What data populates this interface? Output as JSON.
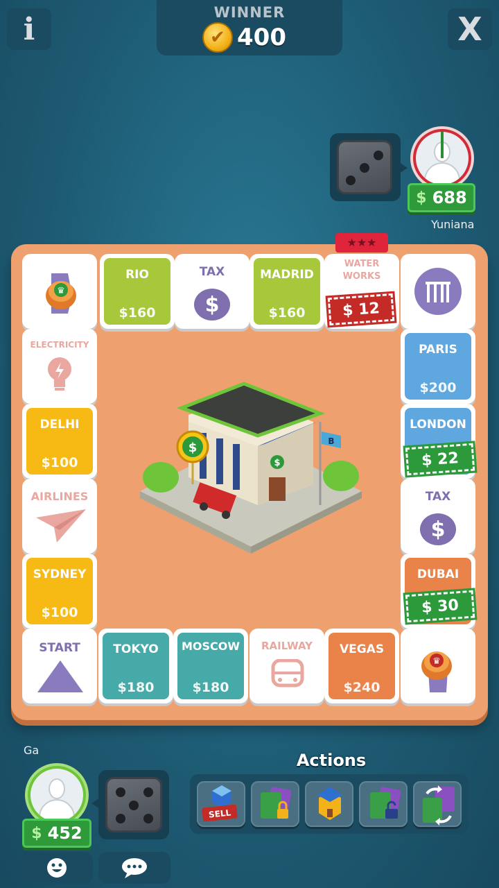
{
  "top_bar": {
    "info_label": "i",
    "winner_label": "WINNER",
    "winner_amount": "400",
    "close_label": "X"
  },
  "opponent": {
    "name": "Yuniana",
    "money": "688",
    "money_sign": "$",
    "dice_value": 3
  },
  "board": {
    "top_row": [
      {
        "id": "corner-jail",
        "type": "corner"
      },
      {
        "name": "RIO",
        "price": "$160",
        "color": "#a6c83a"
      },
      {
        "name": "TAX",
        "icon": "$"
      },
      {
        "name": "MADRID",
        "price": "$160",
        "color": "#a6c83a"
      },
      {
        "name": "WATER WORKS",
        "rent": "$ 12",
        "owner_stars": "★★★"
      },
      {
        "id": "corner-jail-bars",
        "type": "corner"
      }
    ],
    "left_col": [
      {
        "name": "ELECTRICITY"
      },
      {
        "name": "DELHI",
        "price": "$100"
      },
      {
        "name": "AIRLINES"
      },
      {
        "name": "SYDNEY",
        "price": "$100"
      }
    ],
    "right_col": [
      {
        "name": "PARIS",
        "price": "$200"
      },
      {
        "name": "LONDON",
        "rent": "$ 22"
      },
      {
        "name": "TAX",
        "icon": "$"
      },
      {
        "name": "DUBAI",
        "rent": "$ 30"
      }
    ],
    "bottom_row": [
      {
        "name": "START"
      },
      {
        "name": "TOKYO",
        "price": "$180"
      },
      {
        "name": "MOSCOW",
        "price": "$180"
      },
      {
        "name": "RAILWAY"
      },
      {
        "name": "VEGAS",
        "price": "$240"
      }
    ],
    "bank_flag": "B",
    "bank_coin": "$"
  },
  "player": {
    "name": "Ga",
    "money": "452",
    "money_sign": "$",
    "dice_value": 5
  },
  "actions": {
    "title": "Actions",
    "sell_label": "SELL",
    "items": [
      "sell-building",
      "mortgage-lock",
      "build-house",
      "unmortgage",
      "trade"
    ]
  },
  "colors": {
    "background": "#1f5f78",
    "board": "#efa06f",
    "money_green": "#2e9a3a"
  }
}
